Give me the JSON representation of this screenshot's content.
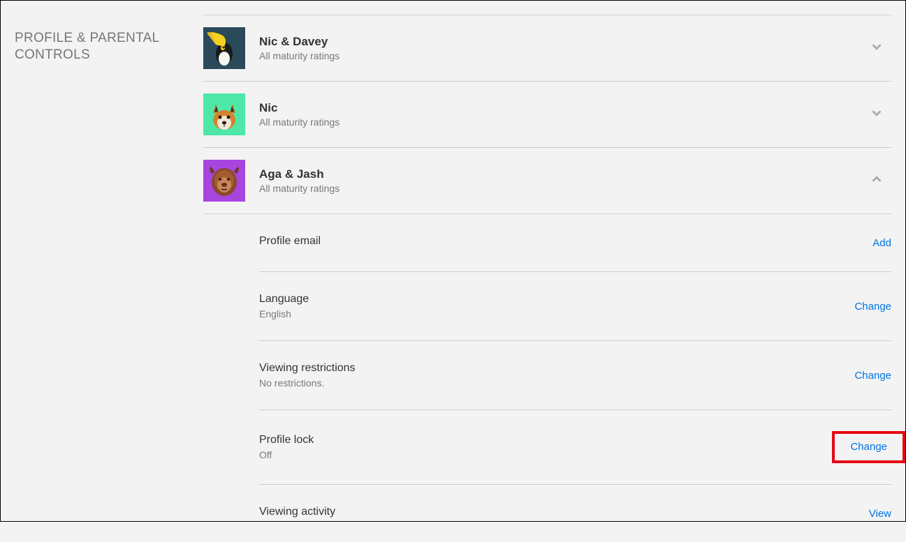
{
  "sectionTitle": "PROFILE & PARENTAL CONTROLS",
  "profiles": [
    {
      "name": "Nic & Davey",
      "subtitle": "All maturity ratings",
      "expanded": false
    },
    {
      "name": "Nic",
      "subtitle": "All maturity ratings",
      "expanded": false
    },
    {
      "name": "Aga & Jash",
      "subtitle": "All maturity ratings",
      "expanded": true
    }
  ],
  "details": {
    "profileEmail": {
      "title": "Profile email",
      "action": "Add"
    },
    "language": {
      "title": "Language",
      "value": "English",
      "action": "Change"
    },
    "viewingRestrictions": {
      "title": "Viewing restrictions",
      "value": "No restrictions.",
      "action": "Change"
    },
    "profileLock": {
      "title": "Profile lock",
      "value": "Off",
      "action": "Change"
    },
    "viewingActivity": {
      "title": "Viewing activity",
      "action": "View"
    }
  }
}
